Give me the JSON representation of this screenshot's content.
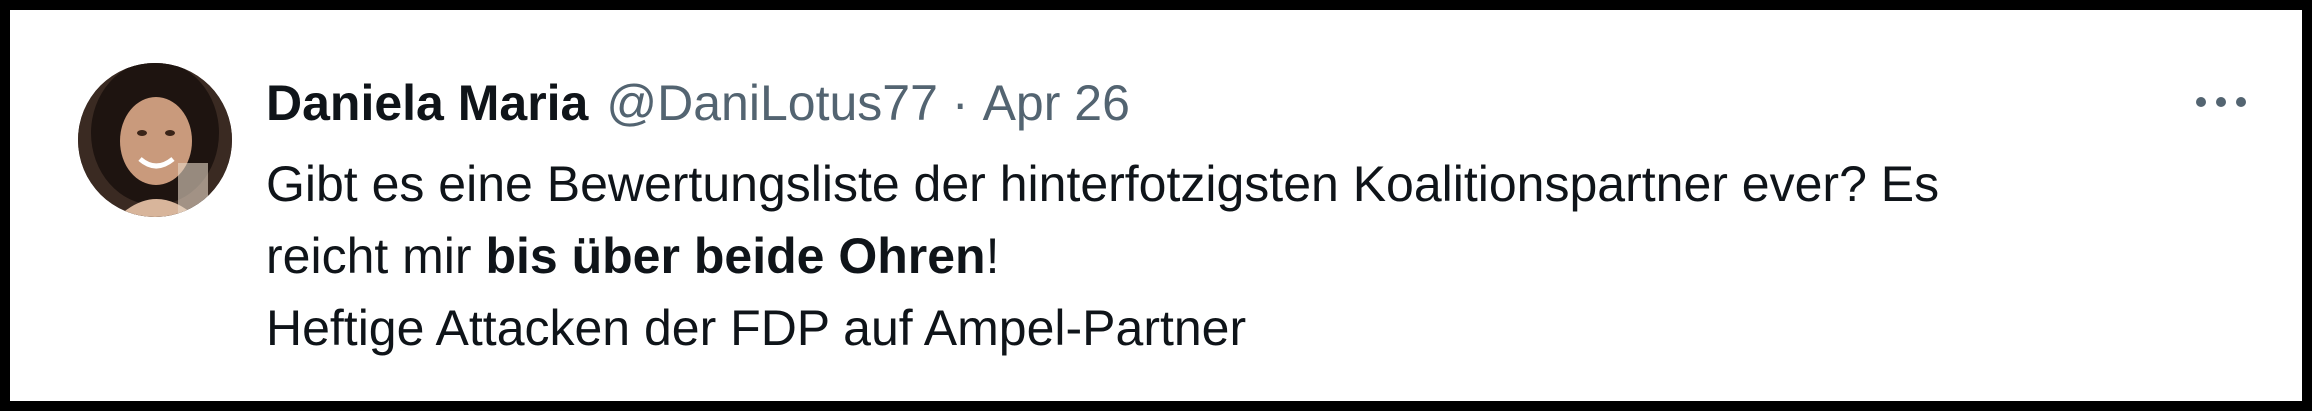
{
  "tweet": {
    "author_name": "Daniela Maria",
    "handle": "@DaniLotus77",
    "separator": "·",
    "date": "Apr 26",
    "more_icon": "more-horizontal-icon",
    "text_line1": "Gibt es eine Bewertungsliste der hinterfotzigsten Koalitionspartner ever? Es",
    "text_line2_prefix": "reicht mir ",
    "text_line2_bold": "bis über beide Ohren",
    "text_line2_suffix": "!",
    "text_line3": "Heftige Attacken der FDP auf Ampel-Partner"
  },
  "colors": {
    "text_primary": "#0f1419",
    "text_secondary": "#536471",
    "border": "#000000",
    "background": "#ffffff"
  }
}
